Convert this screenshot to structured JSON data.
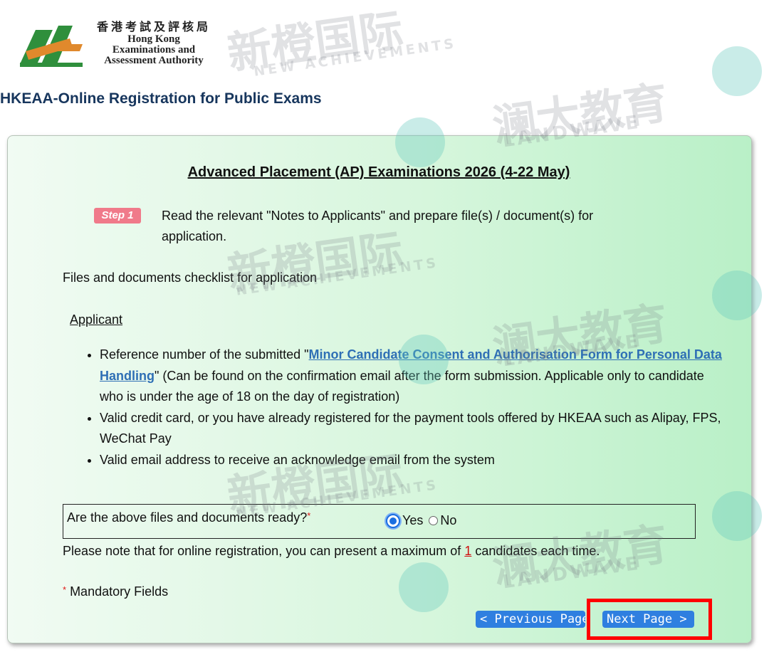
{
  "header": {
    "logo_cn": "香港考試及評核局",
    "logo_en_line1": "Hong Kong",
    "logo_en_line2": "Examinations and",
    "logo_en_line3": "Assessment Authority",
    "page_title": "HKEAA-Online Registration for Public Exams"
  },
  "main": {
    "exam_title": "Advanced Placement (AP) Examinations 2026 (4-22 May)",
    "step_badge": "Step 1",
    "step_text": "Read the relevant \"Notes to Applicants\" and prepare file(s) / document(s) for application.",
    "checklist_title": "Files and documents checklist for application",
    "applicant_heading": "Applicant",
    "bullets": {
      "b1_prefix": "Reference number of the submitted \"",
      "b1_link": "Minor Candidate Consent and Authorisation Form for Personal Data Handling",
      "b1_suffix": "\" (Can be found on the confirmation email after the form submission. Applicable only to candidate who is under the age of 18 on the day of registration)",
      "b2": "Valid credit card, or you have already registered for the payment tools offered by HKEAA such as Alipay, FPS, WeChat Pay",
      "b3": "Valid email address to receive an acknowledge email from the system"
    },
    "question": {
      "label": "Are the above files and documents ready?",
      "required_mark": "*",
      "options": [
        "Yes",
        "No"
      ],
      "selected": "Yes"
    },
    "note_prefix": "Please note that for online registration, you can present a maximum of ",
    "note_number": "1",
    "note_suffix": " candidates each time.",
    "mandatory_mark": "*",
    "mandatory_text": " Mandatory Fields"
  },
  "buttons": {
    "previous": "< Previous Page",
    "next": "Next Page >"
  },
  "watermarks": {
    "cn1": "新橙国际",
    "en1": "NEW ACHIEVEMENTS",
    "cn2": "澜大教育",
    "en2": "LANDWAVE"
  },
  "colors": {
    "title": "#17365d",
    "link": "#2e6fb5",
    "button": "#2f7fe0",
    "highlight": "#ff0000"
  }
}
